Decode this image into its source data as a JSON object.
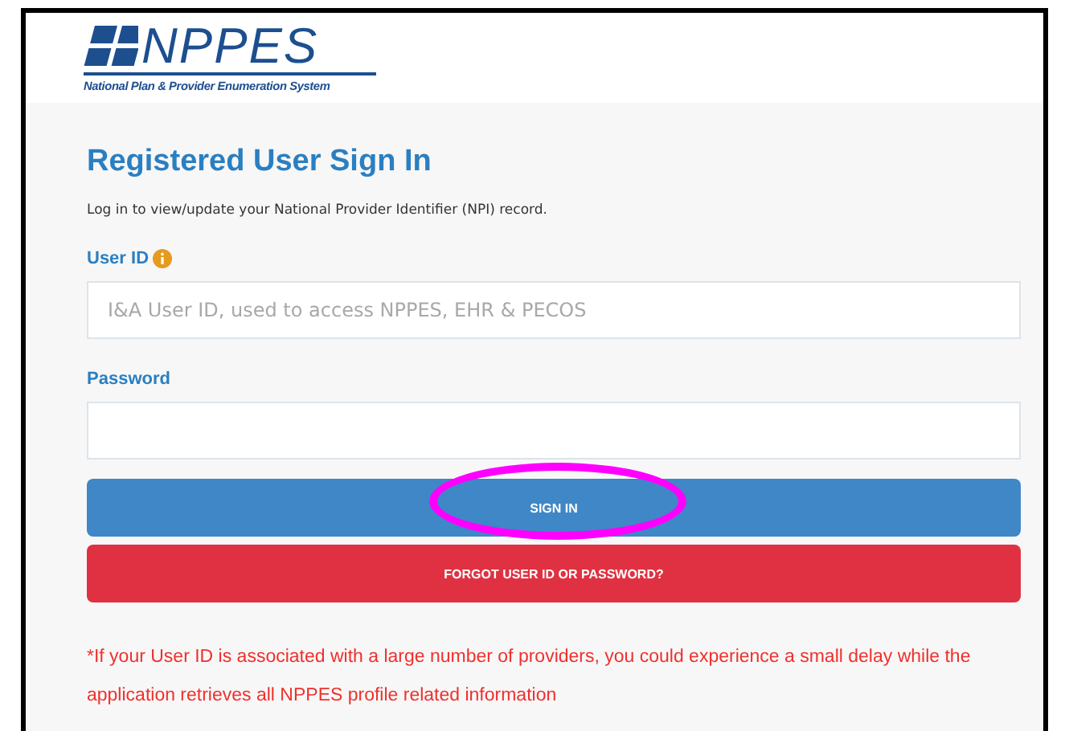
{
  "logo": {
    "name": "NPPES",
    "subtitle": "National Plan & Provider Enumeration System"
  },
  "title": "Registered User Sign In",
  "intro": "Log in to view/update your National Provider Identifier (NPI) record.",
  "fields": [
    {
      "label": "User ID",
      "info": true,
      "placeholder": "I&A User ID, used to access NPPES, EHR & PECOS"
    },
    {
      "label": "Password",
      "info": false
    }
  ],
  "buttons": [
    {
      "label": "SIGN IN",
      "kind": "primary"
    },
    {
      "label": "FORGOT USER ID OR PASSWORD?",
      "kind": "danger"
    }
  ],
  "note": "*If your User ID is associated with a large number of providers, you could experience a small delay while the application retrieves all NPPES profile related information",
  "annotations": [
    {
      "kind": "ellipse",
      "color": "#ff00ff"
    }
  ]
}
